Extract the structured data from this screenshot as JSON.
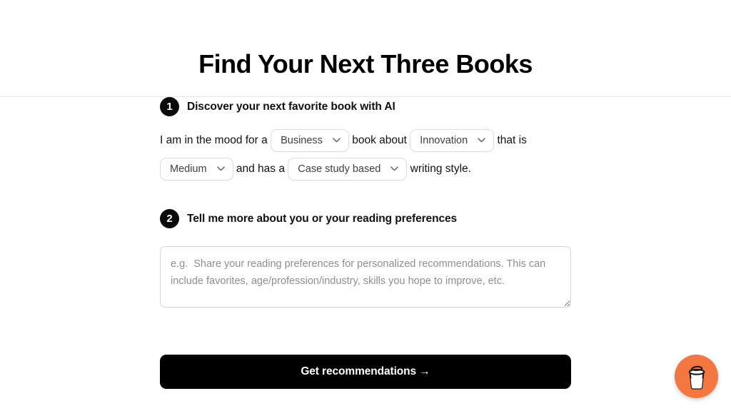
{
  "header": {
    "title": "Find Your Next Three Books"
  },
  "steps": [
    {
      "number": "1",
      "title": "Discover your next favorite book with AI",
      "sentence": {
        "lead": "I am in the mood for a ",
        "mid": " book about ",
        "tail": " that is",
        "second_mid": " and has a ",
        "second_tail": " writing style."
      },
      "dropdowns": [
        {
          "name": "genre",
          "value": "Business",
          "icon": "chevron-down-icon"
        },
        {
          "name": "topic",
          "value": "Innovation",
          "icon": "chevron-down-icon"
        },
        {
          "name": "length",
          "value": "Medium",
          "icon": "chevron-down-icon"
        },
        {
          "name": "style",
          "value": "Case study based",
          "icon": "chevron-down-icon"
        }
      ]
    },
    {
      "number": "2",
      "title": "Tell me more about you or your reading preferences",
      "textarea": {
        "value": "",
        "placeholder": "e.g.  Share your reading preferences for personalized recommendations. This can include favorites, age/profession/industry, skills you hope to improve, etc."
      }
    }
  ],
  "submit": {
    "label": "Get recommendations →"
  },
  "coffee_fab": {
    "icon": "coffee-cup-icon",
    "color": "#f3773f"
  },
  "colors": {
    "accent": "#f3773f",
    "text": "#111111",
    "muted": "#8b8f94",
    "border": "#dcdcdc",
    "button_bg": "#000000"
  }
}
